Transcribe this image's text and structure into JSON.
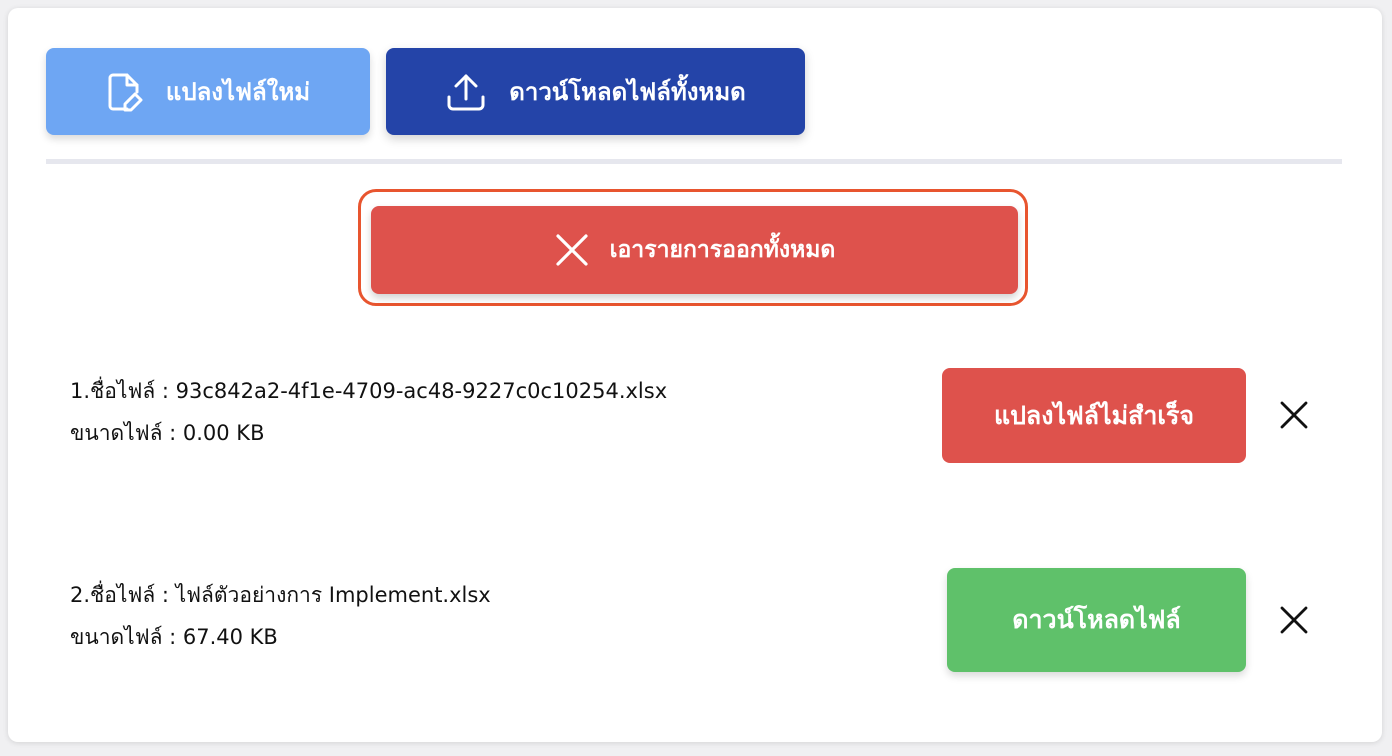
{
  "toolbar": {
    "convert_new_label": "แปลงไฟล์ใหม่",
    "download_all_label": "ดาวน์โหลดไฟล์ทั้งหมด",
    "remove_all_label": "เอารายการออกทั้งหมด"
  },
  "files": [
    {
      "name_line": "1.ชื่อไฟล์ : 93c842a2-4f1e-4709-ac48-9227c0c10254.xlsx",
      "size_line": "ขนาดไฟล์ : 0.00 KB",
      "status_label": "แปลงไฟล์ไม่สำเร็จ",
      "status": "failed"
    },
    {
      "name_line": "2.ชื่อไฟล์ : ไฟล์ตัวอย่างการ Implement.xlsx",
      "size_line": "ขนาดไฟล์ : 67.40 KB",
      "status_label": "ดาวน์โหลดไฟล์",
      "status": "ready"
    }
  ],
  "icons": {
    "convert": "edit-file-icon",
    "download_all": "upload-icon",
    "remove_all": "close-icon",
    "remove_item": "close-icon"
  },
  "colors": {
    "convert_button": "#6ea6f3",
    "download_all_button": "#2444a8",
    "remove_all_button": "#de524c",
    "highlight_ring": "#e8552f",
    "failed_button": "#de524c",
    "download_button": "#5fc16a"
  }
}
